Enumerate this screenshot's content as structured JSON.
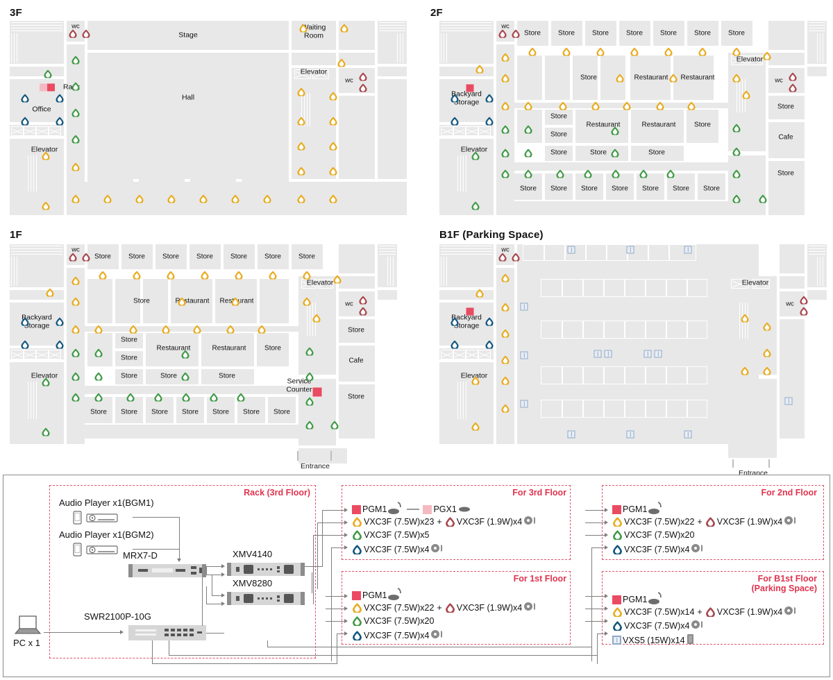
{
  "floors": [
    {
      "id": "3f",
      "title": "3F",
      "rooms": [
        "Stage",
        "Hall",
        "Office",
        "Waiting Room",
        "Elevator",
        "Elevator"
      ],
      "markers": [
        "Rack",
        "wc",
        "wc"
      ],
      "entrance": null
    },
    {
      "id": "2f",
      "title": "2F",
      "rooms": [
        "Store",
        "Restaurant",
        "Cafe",
        "Backyard Storage",
        "Elevator",
        "Elevator"
      ],
      "markers": [
        "wc",
        "wc"
      ],
      "entrance": null
    },
    {
      "id": "1f",
      "title": "1F",
      "rooms": [
        "Store",
        "Restaurant",
        "Cafe",
        "Backyard Storage",
        "Service Counter",
        "Elevator",
        "Elevator"
      ],
      "markers": [
        "wc",
        "wc"
      ],
      "entrance": "Entrance"
    },
    {
      "id": "b1f",
      "title": "B1F (Parking Space)",
      "rooms": [
        "Backyard Storage",
        "Elevator",
        "Elevator"
      ],
      "markers": [
        "wc",
        "wc"
      ],
      "entrance": "Entrance"
    }
  ],
  "labels": {
    "f3_title": "3F",
    "f2_title": "2F",
    "f1_title": "1F",
    "b1_title": "B1F (Parking Space)",
    "stage": "Stage",
    "hall": "Hall",
    "office": "Office",
    "waiting_room": "Waiting\nRoom",
    "waiting_room_l1": "Waiting",
    "waiting_room_l2": "Room",
    "rack": "Rack",
    "elevator": "Elevator",
    "wc": "wc",
    "store": "Store",
    "restaurant": "Restaurant",
    "cafe": "Cafe",
    "backyard_l1": "Backyard",
    "backyard_l2": "Storage",
    "service_l1": "Service",
    "service_l2": "Counter",
    "entrance": "Entrance"
  },
  "colors": {
    "yellow": "#e8ab1d",
    "green": "#3f9a45",
    "blue": "#12567f",
    "red": "#a8474e",
    "accent_red": "#ea4b62",
    "accent_pale": "#f6b9c2",
    "vxs_blue": "#8fa9c8",
    "dashed": "#e0506a",
    "room": "#e8e8e8"
  },
  "system": {
    "rack": {
      "title": "Rack (3rd Floor)",
      "audio1": "Audio Player x1(BGM1)",
      "audio2": "Audio Player x1(BGM2)",
      "mrx": "MRX7-D",
      "swr": "SWR2100P-10G",
      "xmv1": "XMV4140",
      "xmv2": "XMV8280",
      "pc": "PC x 1"
    },
    "zones": [
      {
        "id": "zone-3f",
        "title": "For 3rd Floor",
        "title2": "",
        "rows": [
          {
            "kind": "mic",
            "chip": "accent",
            "label": "PGM1",
            "chip2": "pale",
            "label2": "PGX1"
          },
          {
            "kind": "spk",
            "color": "yellow",
            "label": "VXC3F (7.5W)x23",
            "plus": "+",
            "color2": "red",
            "label2": "VXC3F (1.9W)x4",
            "vol": true
          },
          {
            "kind": "spk",
            "color": "green",
            "label": "VXC3F (7.5W)x5",
            "vol": false
          },
          {
            "kind": "spk",
            "color": "blue",
            "label": "VXC3F (7.5W)x4",
            "vol": true
          }
        ]
      },
      {
        "id": "zone-2f",
        "title": "For 2nd Floor",
        "title2": "",
        "rows": [
          {
            "kind": "mic",
            "chip": "accent",
            "label": "PGM1"
          },
          {
            "kind": "spk",
            "color": "yellow",
            "label": "VXC3F (7.5W)x22",
            "plus": "+",
            "color2": "red",
            "label2": "VXC3F (1.9W)x4",
            "vol": true
          },
          {
            "kind": "spk",
            "color": "green",
            "label": "VXC3F (7.5W)x20",
            "vol": false
          },
          {
            "kind": "spk",
            "color": "blue",
            "label": "VXC3F (7.5W)x4",
            "vol": true
          }
        ]
      },
      {
        "id": "zone-1f",
        "title": "For 1st Floor",
        "title2": "",
        "rows": [
          {
            "kind": "mic",
            "chip": "accent",
            "label": "PGM1"
          },
          {
            "kind": "spk",
            "color": "yellow",
            "label": "VXC3F (7.5W)x22",
            "plus": "+",
            "color2": "red",
            "label2": "VXC3F (1.9W)x4",
            "vol": true
          },
          {
            "kind": "spk",
            "color": "green",
            "label": "VXC3F (7.5W)x20",
            "vol": false
          },
          {
            "kind": "spk",
            "color": "blue",
            "label": "VXC3F (7.5W)x4",
            "vol": true
          }
        ]
      },
      {
        "id": "zone-b1f",
        "title": "For B1st Floor",
        "title2": "(Parking Space)",
        "rows": [
          {
            "kind": "mic",
            "chip": "accent",
            "label": "PGM1"
          },
          {
            "kind": "spk",
            "color": "yellow",
            "label": "VXC3F (7.5W)x14",
            "plus": "+",
            "color2": "red",
            "label2": "VXC3F (1.9W)x4",
            "vol": true
          },
          {
            "kind": "spk",
            "color": "blue",
            "label": "VXC3F (7.5W)x4",
            "vol": true
          },
          {
            "kind": "vxs",
            "label": "VXS5 (15W)x14",
            "spkbox": true
          }
        ]
      }
    ]
  }
}
